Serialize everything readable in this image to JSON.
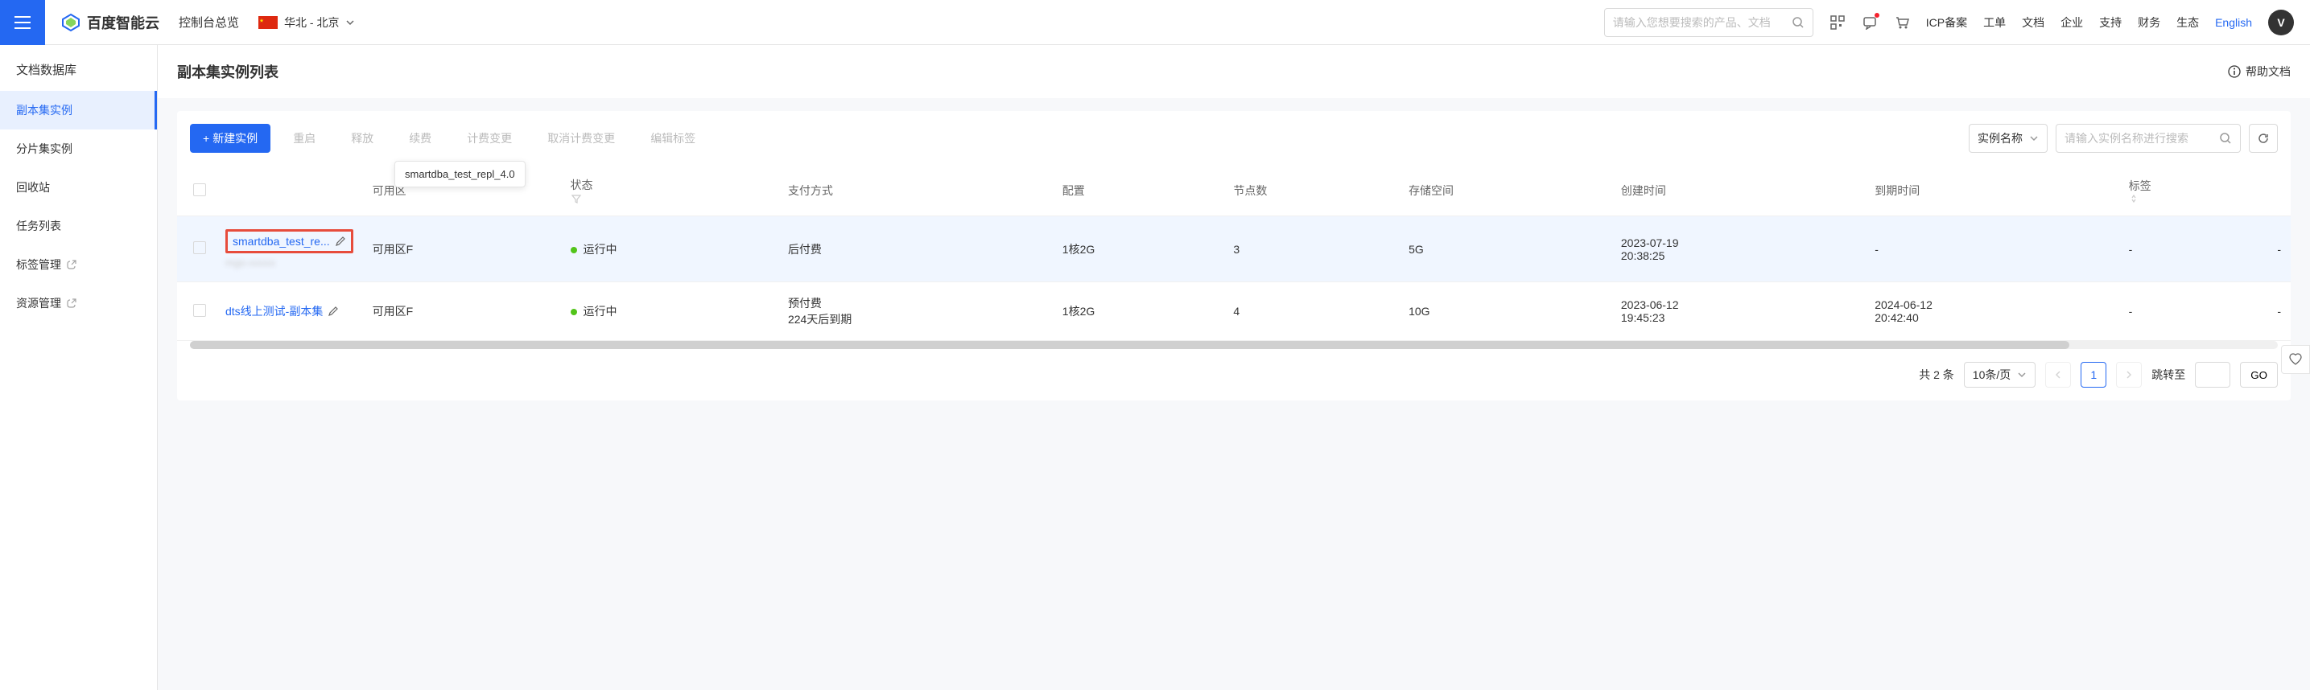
{
  "header": {
    "logo_text": "百度智能云",
    "console_title": "控制台总览",
    "region_text": "华北 - 北京",
    "search_placeholder": "请输入您想要搜索的产品、文档",
    "links": {
      "icp": "ICP备案",
      "ticket": "工单",
      "docs": "文档",
      "enterprise": "企业",
      "support": "支持",
      "finance": "财务",
      "ecosystem": "生态",
      "english": "English"
    },
    "avatar_initial": "V"
  },
  "sidebar": {
    "title": "文档数据库",
    "items": [
      {
        "label": "副本集实例",
        "active": true
      },
      {
        "label": "分片集实例",
        "active": false
      },
      {
        "label": "回收站",
        "active": false
      },
      {
        "label": "任务列表",
        "active": false
      },
      {
        "label": "标签管理",
        "active": false,
        "external": true
      },
      {
        "label": "资源管理",
        "active": false,
        "external": true
      }
    ]
  },
  "page": {
    "title": "副本集实例列表",
    "help_label": "帮助文档"
  },
  "toolbar": {
    "create_label": "新建实例",
    "restart_label": "重启",
    "release_label": "释放",
    "renew_label": "续费",
    "change_billing_label": "计费变更",
    "cancel_billing_label": "取消计费变更",
    "edit_tags_label": "编辑标签",
    "filter_by_label": "实例名称",
    "filter_placeholder": "请输入实例名称进行搜索"
  },
  "table": {
    "tooltip_full_name": "smartdba_test_repl_4.0",
    "columns": {
      "zone": "可用区",
      "status": "状态",
      "payment": "支付方式",
      "config": "配置",
      "nodes": "节点数",
      "storage": "存储空间",
      "created": "创建时间",
      "expires": "到期时间",
      "tags": "标签"
    },
    "rows": [
      {
        "name": "smartdba_test_re...",
        "id_masked": "mgo-xxxxx",
        "zone": "可用区F",
        "status": "运行中",
        "payment": "后付费",
        "config": "1核2G",
        "nodes": "3",
        "storage": "5G",
        "created": "2023-07-19 20:38:25",
        "expires": "-",
        "tags": "-",
        "highlight": true,
        "boxed": true
      },
      {
        "name": "dts线上测试-副本集",
        "id_masked": "",
        "zone": "可用区F",
        "status": "运行中",
        "payment": "预付费\n224天后到期",
        "config": "1核2G",
        "nodes": "4",
        "storage": "10G",
        "created": "2023-06-12 19:45:23",
        "expires": "2024-06-12 20:42:40",
        "tags": "-",
        "highlight": false,
        "boxed": false
      }
    ]
  },
  "pagination": {
    "total_text": "共 2 条",
    "per_page_label": "10条/页",
    "current_page": "1",
    "jump_label": "跳转至",
    "go_label": "GO"
  }
}
